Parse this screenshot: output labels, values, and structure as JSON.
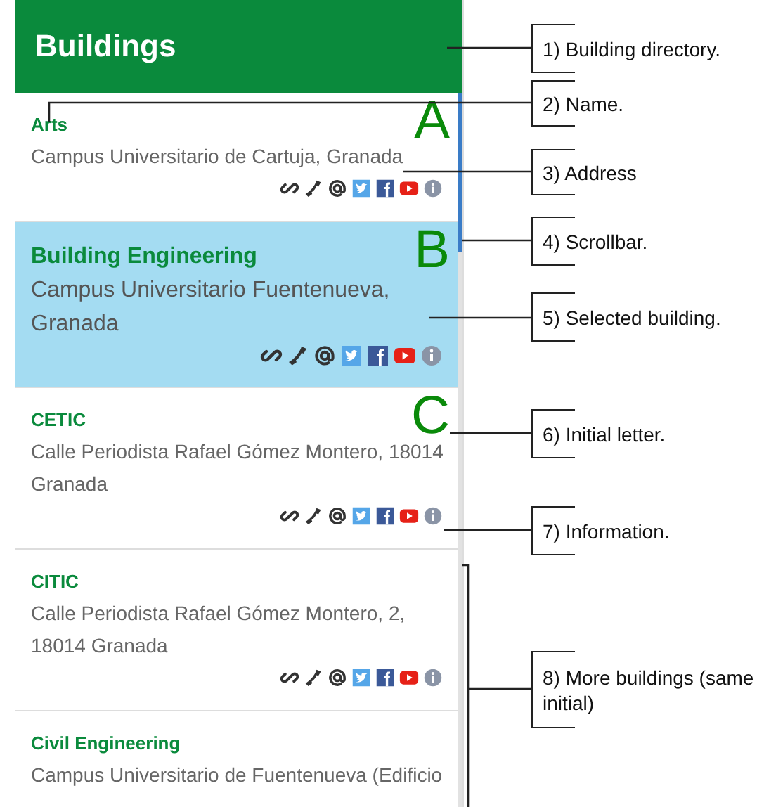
{
  "header": {
    "title": "Buildings"
  },
  "buildings": [
    {
      "name": "Arts",
      "address": "Campus Universitario de Cartuja, Granada",
      "initial": "A",
      "selected": false,
      "cut_off": false
    },
    {
      "name": "Building Engineering",
      "address": "Campus Universitario Fuentenueva, Granada",
      "initial": "B",
      "selected": true,
      "cut_off": false
    },
    {
      "name": "CETIC",
      "address": "Calle Periodista Rafael Gómez Montero, 18014 Granada",
      "initial": "C",
      "selected": false,
      "cut_off": false
    },
    {
      "name": "CITIC",
      "address": "Calle Periodista Rafael Gómez Montero, 2, 18014 Granada",
      "selected": false,
      "cut_off": false
    },
    {
      "name": "Civil Engineering",
      "address": "Campus Universitario de Fuentenueva (Edificio",
      "selected": false,
      "cut_off": true
    }
  ],
  "callouts": [
    "1) Building directory.",
    "2) Name.",
    "3) Address",
    "4) Scrollbar.",
    "5) Selected building.",
    "6) Initial letter.",
    "7) Information.",
    "8) More buildings (same initial)"
  ]
}
